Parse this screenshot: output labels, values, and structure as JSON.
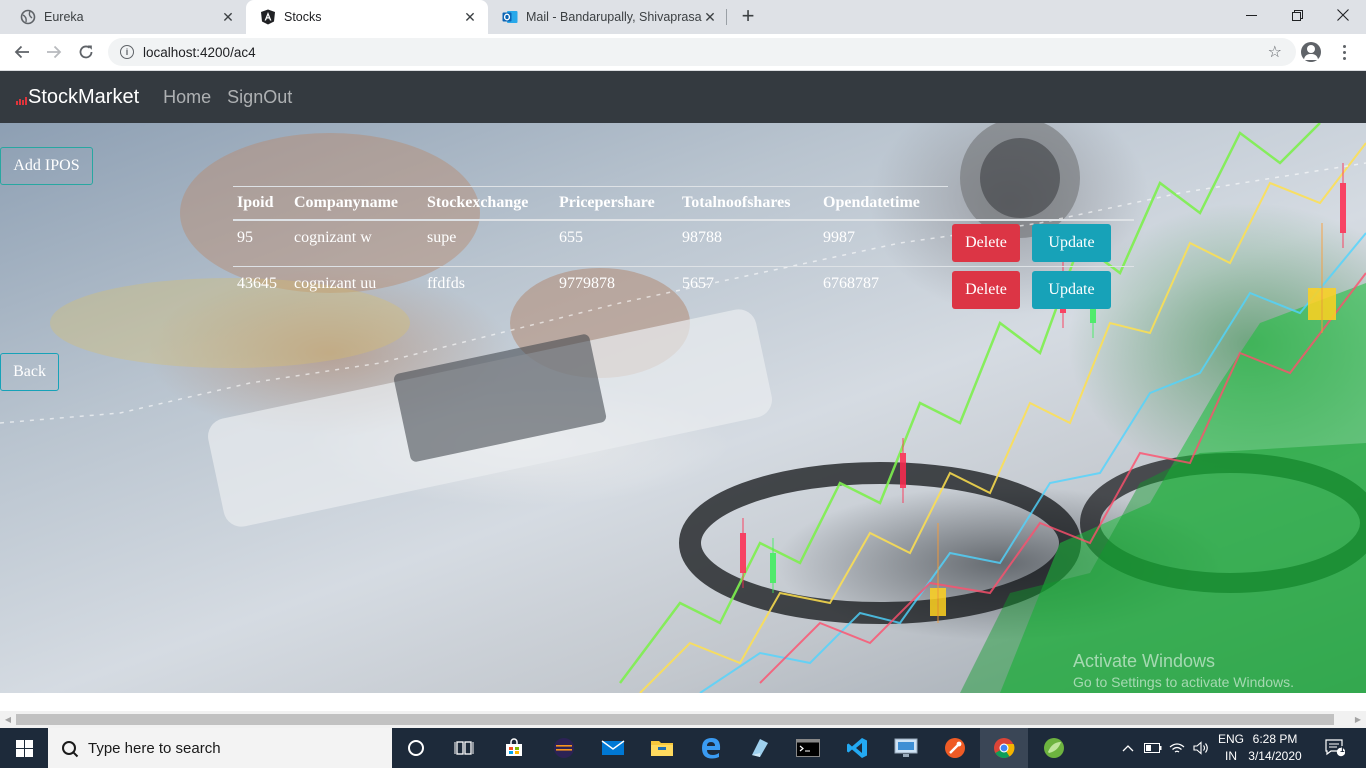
{
  "browser": {
    "tabs": [
      {
        "title": "Eureka",
        "icon": "globe-icon",
        "active": false
      },
      {
        "title": "Stocks",
        "icon": "angular-icon",
        "active": true
      },
      {
        "title": "Mail - Bandarupally, Shivaprasad",
        "icon": "outlook-icon",
        "active": false
      }
    ],
    "url": "localhost:4200/ac4"
  },
  "app": {
    "brand": "StockMarket",
    "nav": {
      "home": "Home",
      "signout": "SignOut"
    },
    "add_button": "Add IPOS",
    "back_button": "Back",
    "table": {
      "columns": [
        "Ipoid",
        "Companyname",
        "Stockexchange",
        "Pricepershare",
        "Totalnoofshares",
        "Opendatetime"
      ],
      "rows": [
        {
          "ipoid": "95",
          "companyname": "cognizant w",
          "stockexchange": "supe",
          "pricepershare": "655",
          "totalnoofshares": "98788",
          "opendatetime": "9987"
        },
        {
          "ipoid": "43645",
          "companyname": "cognizant uu",
          "stockexchange": "ffdfds",
          "pricepershare": "9779878",
          "totalnoofshares": "5657",
          "opendatetime": "6768787"
        }
      ],
      "delete_label": "Delete",
      "update_label": "Update"
    }
  },
  "watermark": {
    "title": "Activate Windows",
    "subtitle": "Go to Settings to activate Windows."
  },
  "taskbar": {
    "search_placeholder": "Type here to search",
    "language": {
      "line1": "ENG",
      "line2": "IN"
    },
    "time": "6:28 PM",
    "date": "3/14/2020",
    "notification_count": "1"
  },
  "colors": {
    "navbar": "#343a40",
    "delete": "#dc3545",
    "update": "#17a2b8",
    "taskbar": "#1d2a3a"
  }
}
